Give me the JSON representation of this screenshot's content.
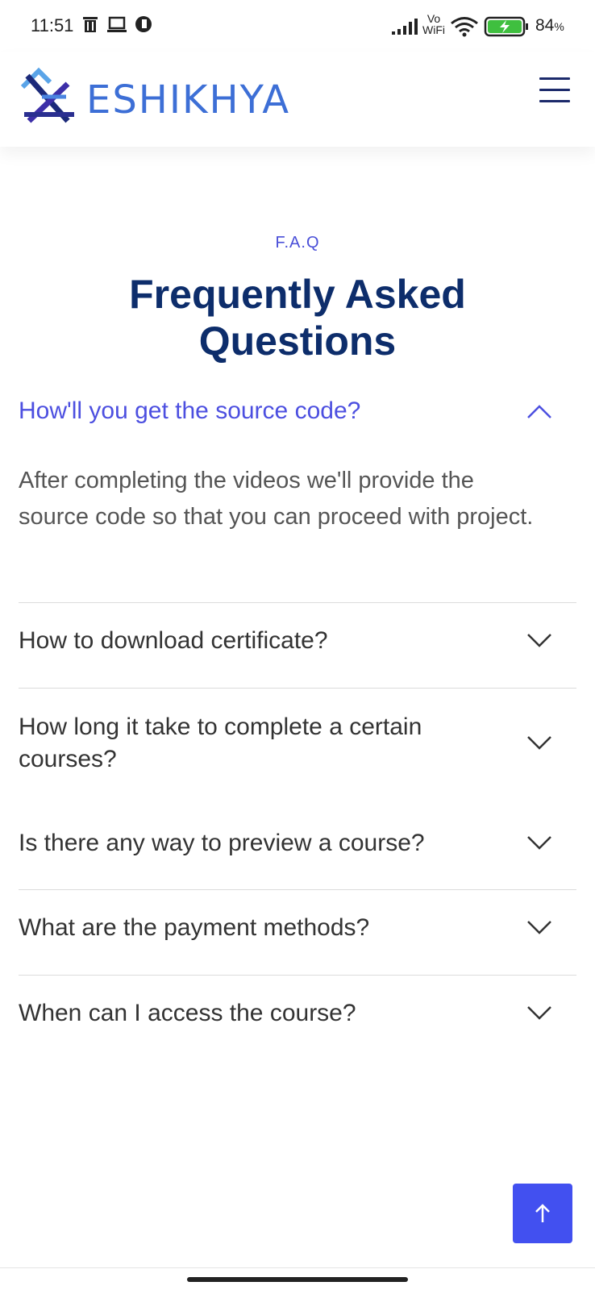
{
  "status_bar": {
    "time": "11:51",
    "network_label_top": "Vo",
    "network_label_bottom": "WiFi",
    "battery_percent": "84",
    "battery_unit": "%"
  },
  "header": {
    "brand": "ESHIKHYA",
    "menu_icon": "hamburger-icon"
  },
  "faq": {
    "kicker": "F.A.Q",
    "title": "Frequently Asked Questions",
    "items": [
      {
        "question": "How'll you get the source code?",
        "answer": "After completing the videos we'll provide the source code so that you can proceed with project.",
        "expanded": true
      },
      {
        "question": "How to download certificate?",
        "expanded": false
      },
      {
        "question": "How long it take to complete a certain courses?",
        "expanded": false
      },
      {
        "question": "Is there any way to preview a course?",
        "expanded": false
      },
      {
        "question": "What are the payment methods?",
        "expanded": false
      },
      {
        "question": "When can I access the course?",
        "expanded": false
      }
    ]
  },
  "back_to_top_icon": "arrow-up-icon",
  "colors": {
    "accent": "#4c4fe0",
    "title": "#0d2d6b",
    "button": "#4250f0"
  }
}
